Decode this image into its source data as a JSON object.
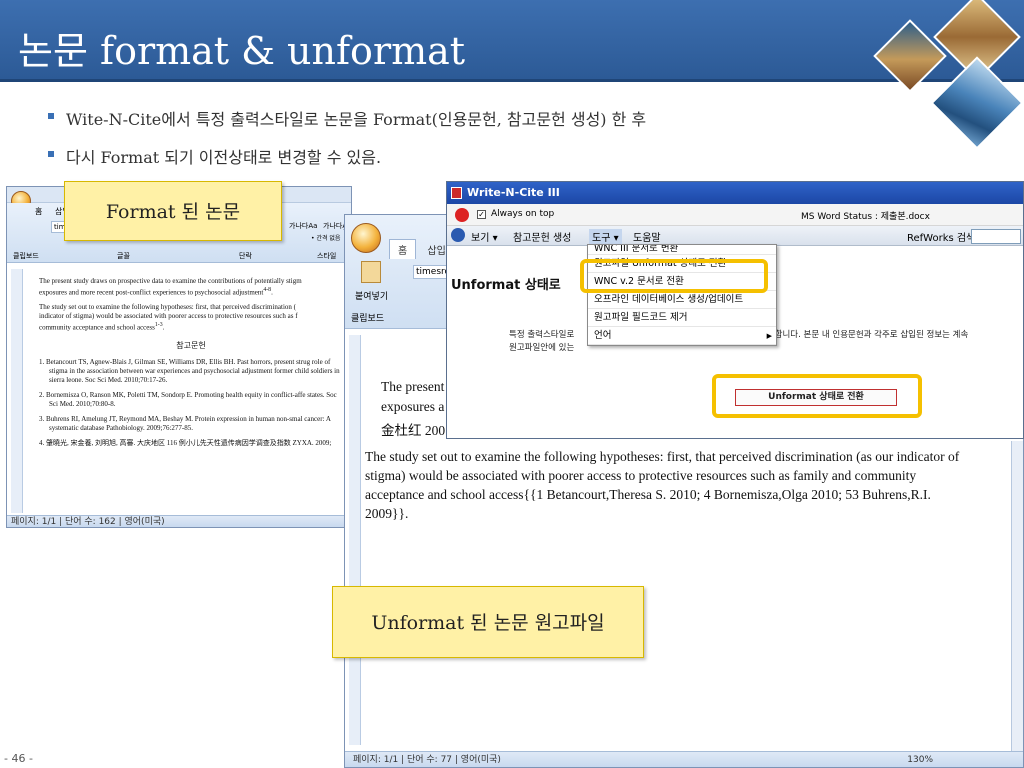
{
  "slide": {
    "title": "논문 format & unformat",
    "bullets": [
      "Wite-N-Cite에서 특정 출력스타일로 논문을 Format(인용문헌, 참고문헌 생성) 한 후",
      "다시 Format 되기 이전상태로 변경할 수 있음."
    ],
    "page_number": "- 46 -",
    "callout_formatted": "Format 된 논문",
    "callout_unformatted": "Unformat 된 논문 원고파일",
    "accent_color": "#2c5a96",
    "callout_color": "#fff1a6",
    "highlight_color": "#f5c000"
  },
  "word_formatted": {
    "ribbon_font": "timesro",
    "ribbon_style1": "가나다Aa",
    "ribbon_style2": "가나다Aa",
    "ribbon_style3": "가",
    "ribbon_style_label": "• 간격 없음",
    "ribbon_groups": [
      "클립보드",
      "글꼴",
      "단락",
      "스타일"
    ],
    "tab_home": "홈",
    "tab_insert": "삽입",
    "para1": "The present study draws on prospective data to examine the contributions of potentially stigm",
    "para1b": "exposures and more recent post-conflict experiences to psychosocial adjustment",
    "para1_sup": "4-8",
    "para2": "The study set out to examine the following hypotheses: first, that perceived discrimination (",
    "para2b": "indicator of stigma) would be associated with poorer access to protective resources such as f",
    "para2c": "community acceptance and school access",
    "para2_sup": "1-3",
    "ref_title": "참고문헌",
    "refs": [
      "1. Betancourt TS, Agnew-Blais J, Gilman SE, Williams DR, Ellis BH. Past horrors, present strug role of stigma in the association between war experiences and psychosocial adjustment former child soldiers in sierra leone. Soc Sci Med. 2010;70:17-26.",
      "2. Bornemisza O, Ranson MK, Poletti TM, Sondorp E. Promoting health equity in conflict-affe states. Soc Sci Med. 2010;70:80-8.",
      "3. Buhrens RI, Amelung JT, Reymond MA, Beshay M. Protein expression in human non-smal cancer: A systematic database Pathobiology. 2009;76:277-85.",
      "4. 肇曉光, 宋金養, 刘明旭, 高審. 大庆地区 116 例小儿先天性遗传病因学调查及指数 ZYXA. 2009;"
    ],
    "status": "페이지: 1/1 | 단어 수: 162 | 영어(미국)"
  },
  "word_unformatted": {
    "tab_home": "홈",
    "tab_insert": "삽입",
    "paste_label": "붙여넣기",
    "font_name": "timesro",
    "clipboard_label": "클립보드",
    "fragment1": "The present",
    "fragment2": "exposures a",
    "fragment3": "金杜红 200",
    "paragraph": "The study set out to examine the following hypotheses: first, that perceived discrimination (as our indicator of stigma) would be associated with poorer access to protective resources such as family and community acceptance and school access{{1 Betancourt,Theresa S. 2010; 4 Bornemisza,Olga 2010; 53 Buhrens,R.I. 2009}}.",
    "status_page": "페이지: 1/1",
    "status_words": "단어 수: 77",
    "status_lang": "영어(미국)",
    "zoom": "130%"
  },
  "wnc": {
    "title": "Write-N-Cite III",
    "always_on_top": "Always on top",
    "ms_word_status": "MS Word Status : 제출본.docx",
    "menu": [
      "보기 ▾",
      "참고문헌 생성",
      "도구 ▾",
      "도움말"
    ],
    "refworks_search": "RefWorks 검색",
    "dropdown": [
      "WNC III 문서로 변환",
      "원고파일 Unformat 상태로 전환",
      "WNC v.2 문서로 전환",
      "오프라인 데이터베이스 생성/업데이트",
      "원고파일 필드코드 제거",
      "언어"
    ],
    "heading": "Unformat 상태로",
    "desc_line1": "특정 출력스타일로",
    "desc_line1b": "전환합니다. 본문 내 인용문헌과 각주로 삽입된 정보는 계속",
    "desc_line2": "원고파일안에 있는",
    "button": "Unformat 상태로 전환"
  }
}
